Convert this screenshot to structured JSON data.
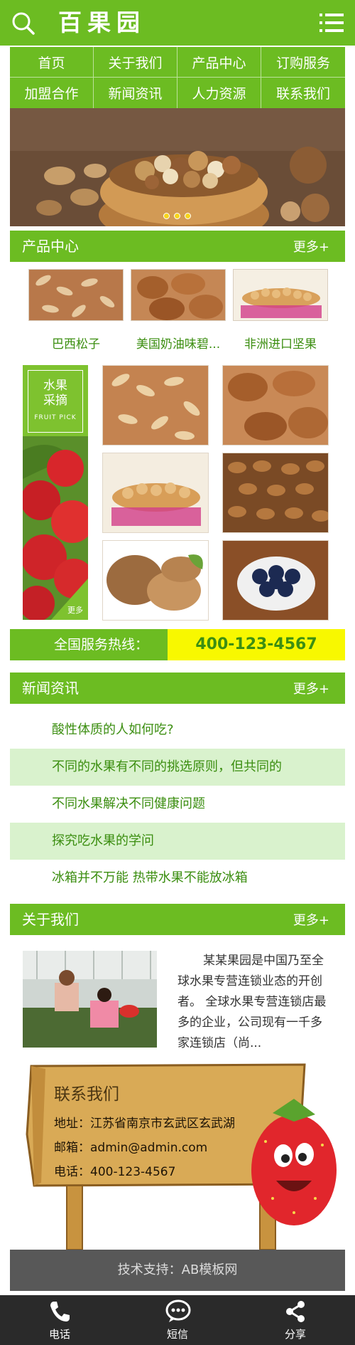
{
  "header": {
    "logo": "百果园",
    "search_icon": "search-icon",
    "menu_icon": "menu-icon"
  },
  "nav": [
    "首页",
    "关于我们",
    "产品中心",
    "订购服务",
    "加盟合作",
    "新闻资讯",
    "人力资源",
    "联系我们"
  ],
  "banner": {
    "slide_count": 3
  },
  "products": {
    "title": "产品中心",
    "more": "更多+",
    "items": [
      "巴西松子",
      "美国奶油味碧...",
      "非洲进口坚果"
    ]
  },
  "fruit_pick": {
    "line1": "水果",
    "line2": "采摘",
    "en": "FRUIT PICK",
    "more": "更多"
  },
  "hotline": {
    "label": "全国服务热线：",
    "number": "400-123-4567"
  },
  "news": {
    "title": "新闻资讯",
    "more": "更多+",
    "items": [
      "酸性体质的人如何吃?",
      "不同的水果有不同的挑选原则，但共同的",
      "不同水果解决不同健康问题",
      "探究吃水果的学问",
      "冰箱并不万能 热带水果不能放冰箱"
    ]
  },
  "about": {
    "title": "关于我们",
    "more": "更多+",
    "text": "某某果园是中国乃至全球水果专营连锁业态的开创者。 全球水果专营连锁店最多的企业，公司现有一千多家连锁店（尚..."
  },
  "contact": {
    "title": "联系我们",
    "address": "地址：江苏省南京市玄武区玄武湖",
    "email": "邮箱：admin@admin.com",
    "phone": "电话：400-123-4567"
  },
  "footer": {
    "support": "技术支持：AB模板网",
    "tabs": [
      {
        "label": "电话",
        "icon": "phone-icon"
      },
      {
        "label": "短信",
        "icon": "chat-icon"
      },
      {
        "label": "分享",
        "icon": "share-icon"
      }
    ]
  },
  "colors": {
    "brand_green": "#6cbc22",
    "dark_green": "#3b8e10",
    "light_green": "#d9f2cd",
    "hotline_yellow": "#f8f800",
    "footer_dark": "#2a2a2a"
  }
}
